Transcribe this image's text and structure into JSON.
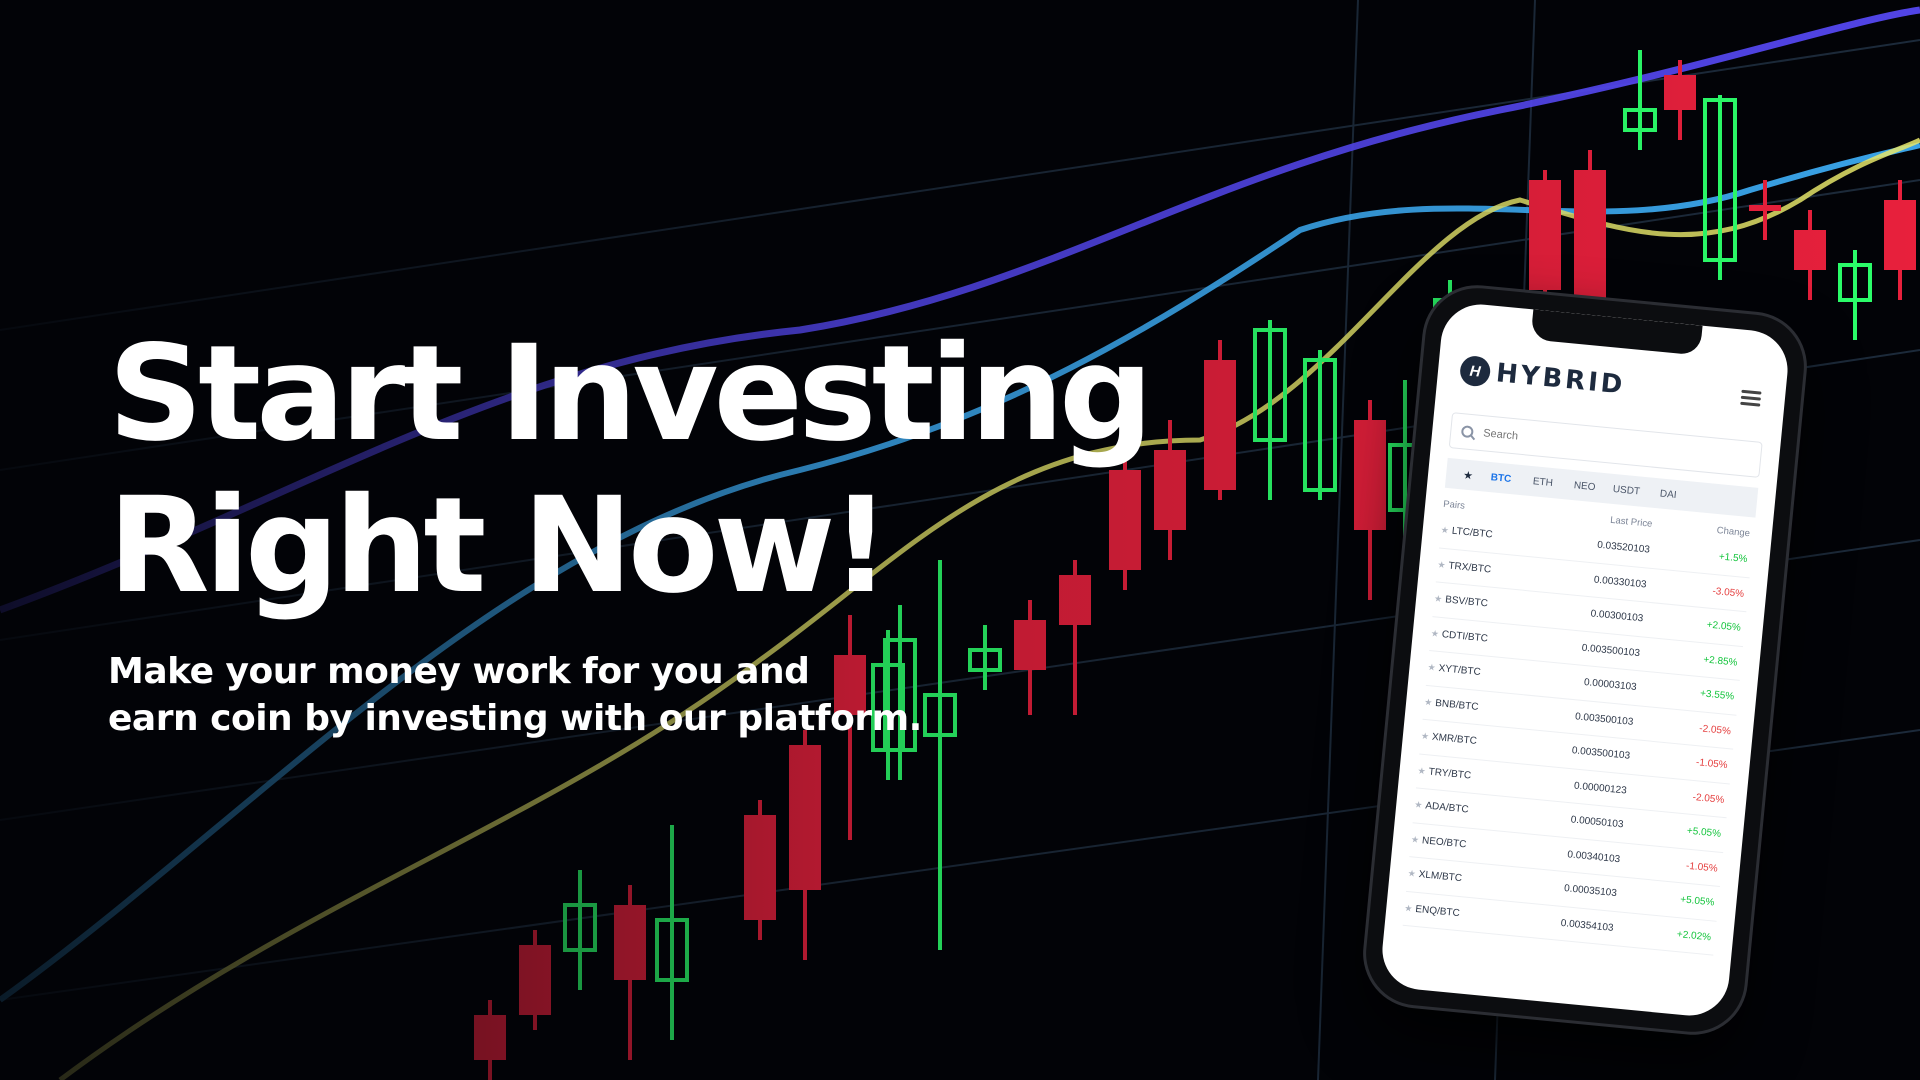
{
  "hero": {
    "headline_line1": "Start Investing",
    "headline_line2": "Right Now!",
    "sub_line1": "Make your money work for you and",
    "sub_line2": "earn coin by investing with our platform."
  },
  "app": {
    "brand": "HYBRID",
    "logo_letter": "H",
    "search_placeholder": "Search",
    "star_tab": "★",
    "tabs": [
      "BTC",
      "ETH",
      "NEO",
      "USDT",
      "DAI"
    ],
    "active_tab": "BTC",
    "columns": {
      "pair": "Pairs",
      "price": "Last Price",
      "change": "Change"
    },
    "rows": [
      {
        "pair": "LTC/BTC",
        "price": "0.03520103",
        "change": "+1.5%",
        "dir": "pos"
      },
      {
        "pair": "TRX/BTC",
        "price": "0.00330103",
        "change": "-3.05%",
        "dir": "neg"
      },
      {
        "pair": "BSV/BTC",
        "price": "0.00300103",
        "change": "+2.05%",
        "dir": "pos"
      },
      {
        "pair": "CDTI/BTC",
        "price": "0.003500103",
        "change": "+2.85%",
        "dir": "pos"
      },
      {
        "pair": "XYT/BTC",
        "price": "0.00003103",
        "change": "+3.55%",
        "dir": "pos"
      },
      {
        "pair": "BNB/BTC",
        "price": "0.003500103",
        "change": "-2.05%",
        "dir": "neg"
      },
      {
        "pair": "XMR/BTC",
        "price": "0.003500103",
        "change": "-1.05%",
        "dir": "neg"
      },
      {
        "pair": "TRY/BTC",
        "price": "0.00000123",
        "change": "-2.05%",
        "dir": "neg"
      },
      {
        "pair": "ADA/BTC",
        "price": "0.00050103",
        "change": "+5.05%",
        "dir": "pos"
      },
      {
        "pair": "NEO/BTC",
        "price": "0.00340103",
        "change": "-1.05%",
        "dir": "neg"
      },
      {
        "pair": "XLM/BTC",
        "price": "0.00035103",
        "change": "+5.05%",
        "dir": "pos"
      },
      {
        "pair": "ENQ/BTC",
        "price": "0.00354103",
        "change": "+2.02%",
        "dir": "pos"
      }
    ]
  },
  "colors": {
    "background": "#020307",
    "candle_up": "#2bff6a",
    "candle_down": "#e8203c",
    "line_purple": "#5a4bff",
    "line_blue": "#3fb4ff",
    "line_yellow": "#e8e86a",
    "grid": "#1c2a3a"
  }
}
